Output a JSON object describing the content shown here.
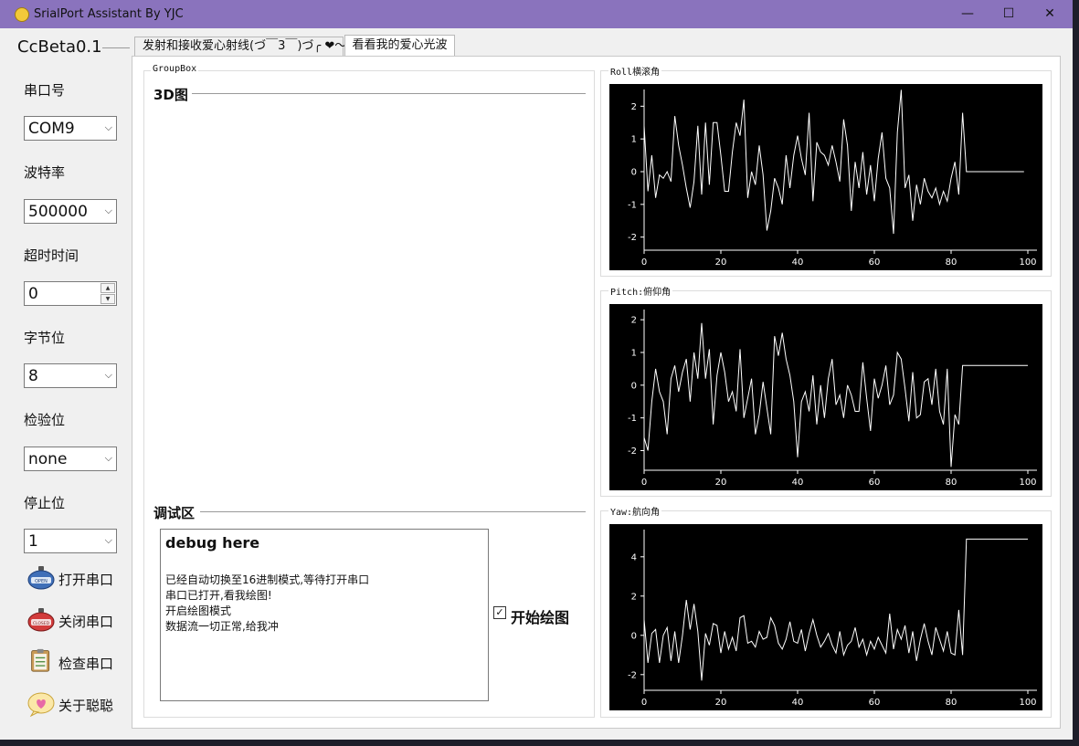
{
  "window": {
    "title": "SrialPort Assistant By YJC",
    "minimize": "—",
    "maximize": "☐",
    "close": "✕"
  },
  "sidebar": {
    "brand": "CcBeta0.1",
    "port_label": "串口号",
    "port_value": "COM9",
    "baud_label": "波特率",
    "baud_value": "500000",
    "timeout_label": "超时时间",
    "timeout_value": "0",
    "databits_label": "字节位",
    "databits_value": "8",
    "parity_label": "检验位",
    "parity_value": "none",
    "stopbits_label": "停止位",
    "stopbits_value": "1",
    "open_label": "打开串口",
    "close_label": "关闭串口",
    "check_label": "检查串口",
    "about_label": "关于聪聪",
    "icons": [
      "open-badge-icon",
      "closed-badge-icon",
      "clipboard-icon",
      "heart-bubble-icon"
    ]
  },
  "tabs": [
    {
      "label": "发射和接收爱心射线(づ￣3￣)づ╭ ❤～"
    },
    {
      "label": "看看我的爱心光波"
    }
  ],
  "main": {
    "groupbox_title": "GroupBox",
    "view3d_label": "3D图",
    "debug_section_label": "调试区",
    "debug_title": "debug here",
    "debug_lines": [
      "已经自动切换至16进制模式,等待打开串口",
      "串口已打开,看我绘图!",
      "开启绘图模式",
      "数据流一切正常,给我冲"
    ],
    "draw_checkbox_label": "开始绘图",
    "draw_checked": true
  },
  "chart_data": [
    {
      "type": "line",
      "title": "Roll横滚角",
      "xlim": [
        0,
        100
      ],
      "ylim": [
        -2.4,
        2.4
      ],
      "x_ticks": [
        0,
        20,
        40,
        60,
        80,
        100
      ],
      "y_ticks": [
        -2,
        -1,
        0,
        1,
        2
      ],
      "grid": false,
      "y": [
        1.4,
        -0.6,
        0.5,
        -0.8,
        -0.1,
        -0.2,
        0,
        -0.3,
        1.7,
        0.8,
        0.2,
        -0.5,
        -1.1,
        -0.3,
        1.4,
        -0.7,
        1.5,
        -0.4,
        1.5,
        1.5,
        0.5,
        -0.6,
        -0.6,
        0.6,
        1.5,
        1.1,
        2.2,
        -0.8,
        0,
        -0.4,
        0.8,
        -0.1,
        -1.8,
        -1.2,
        -0.2,
        -0.5,
        -1,
        0.5,
        -0.5,
        0.5,
        1.1,
        0.4,
        -0.1,
        1.8,
        -0.9,
        0.9,
        0.6,
        0.5,
        0.2,
        0.8,
        0.3,
        -0.3,
        1.6,
        0.8,
        -1.2,
        0.3,
        -0.5,
        0.6,
        -0.7,
        0.2,
        -0.9,
        0.4,
        1.2,
        -0.2,
        -0.5,
        -1.9,
        1.2,
        2.5,
        -0.5,
        -0.1,
        -1.5,
        -0.4,
        -1,
        -0.2,
        -0.6,
        -0.8,
        -0.5,
        -1,
        -0.6,
        -0.9,
        -0.2,
        0.3,
        -0.7,
        1.8,
        0,
        0,
        0,
        0,
        0,
        0,
        0,
        0,
        0,
        0,
        0,
        0,
        0,
        0,
        0,
        0
      ],
      "fill": "#000000",
      "line": "#ffffff"
    },
    {
      "type": "line",
      "title": "Pitch:俯仰角",
      "xlim": [
        0,
        100
      ],
      "ylim": [
        -2.6,
        2.2
      ],
      "x_ticks": [
        0,
        20,
        40,
        60,
        80,
        100
      ],
      "y_ticks": [
        -2,
        -1,
        0,
        1,
        2
      ],
      "grid": false,
      "y": [
        -1.6,
        -2,
        -0.5,
        0.5,
        -0.2,
        -0.5,
        -1.5,
        0.2,
        0.6,
        -0.2,
        0.4,
        0.8,
        -0.5,
        1,
        0.2,
        1.9,
        0.2,
        1.1,
        -1.2,
        0.3,
        1,
        0.4,
        -0.5,
        -0.2,
        -0.8,
        1.1,
        -1,
        -0.4,
        0.2,
        -1.5,
        -0.9,
        0.1,
        -0.7,
        -1.5,
        1.5,
        0.9,
        1.6,
        0.8,
        0.3,
        -0.5,
        -2.2,
        -0.5,
        -0.2,
        -0.8,
        0.3,
        -1.2,
        0,
        -1,
        0.2,
        0.8,
        -0.6,
        -0.3,
        -1,
        0,
        -0.3,
        -0.8,
        -0.8,
        0.7,
        -0.4,
        -1.4,
        0.2,
        -0.4,
        0,
        0.6,
        -0.6,
        -0.3,
        1,
        0.8,
        -0.1,
        -1.1,
        0.4,
        -1,
        -0.9,
        0.1,
        0.2,
        -0.6,
        0.5,
        -0.8,
        -1.2,
        0.5,
        -2.5,
        -0.9,
        -1.2,
        0.6,
        0.6,
        0.6,
        0.6,
        0.6,
        0.6,
        0.6,
        0.6,
        0.6,
        0.6,
        0.6,
        0.6,
        0.6,
        0.6,
        0.6,
        0.6,
        0.6,
        0.6
      ],
      "fill": "#000000",
      "line": "#ffffff"
    },
    {
      "type": "line",
      "title": "Yaw:航向角",
      "xlim": [
        0,
        100
      ],
      "ylim": [
        -2.8,
        5.2
      ],
      "x_ticks": [
        0,
        20,
        40,
        60,
        80,
        100
      ],
      "y_ticks": [
        -2,
        0,
        2,
        4
      ],
      "grid": false,
      "y": [
        0.8,
        -1.4,
        0.1,
        0.3,
        -1.4,
        0,
        0.4,
        -1.3,
        0.2,
        -1.4,
        0,
        1.8,
        0.3,
        1.6,
        0.2,
        -2.3,
        0.1,
        -0.5,
        0.6,
        0.5,
        -0.9,
        0.2,
        -0.7,
        -0.1,
        -0.8,
        0.9,
        1,
        -0.4,
        -0.3,
        -0.6,
        0.2,
        -0.2,
        -0.1,
        0.9,
        0.5,
        -0.4,
        -0.7,
        -0.2,
        0.7,
        -0.3,
        -0.4,
        0.3,
        -0.8,
        0.1,
        0.8,
        0,
        -0.6,
        -0.3,
        0.1,
        -0.5,
        -0.9,
        0.2,
        -1,
        -0.5,
        -0.3,
        0.4,
        -0.6,
        -0.2,
        -1,
        -0.3,
        -0.7,
        -0.1,
        -0.5,
        -0.9,
        1.1,
        -0.7,
        0.3,
        -0.2,
        0.5,
        -0.9,
        0.2,
        -1.3,
        -0.2,
        0.6,
        -0.3,
        -1,
        0.4,
        -0.2,
        -0.8,
        0.2,
        -0.9,
        -1,
        1.3,
        -1,
        4.9,
        4.9,
        4.9,
        4.9,
        4.9,
        4.9,
        4.9,
        4.9,
        4.9,
        4.9,
        4.9,
        4.9,
        4.9,
        4.9,
        4.9,
        4.9,
        4.9
      ],
      "fill": "#000000",
      "line": "#ffffff"
    }
  ]
}
